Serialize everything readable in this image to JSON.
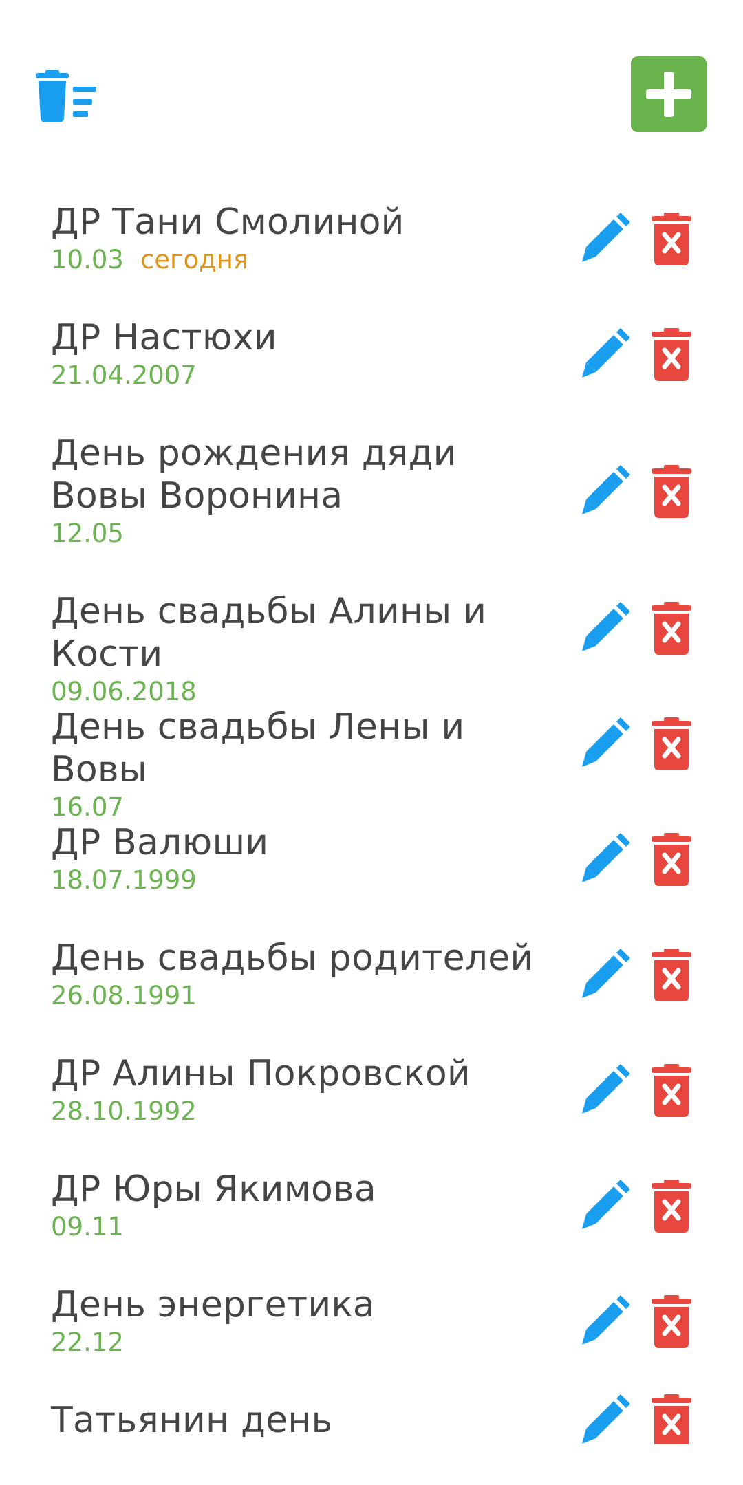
{
  "colors": {
    "accent_blue": "#1a9ff0",
    "add_green": "#6ab24f",
    "delete_red": "#e8473f",
    "date_green": "#6cb352",
    "today_orange": "#e0961a",
    "title_text": "#454545"
  },
  "toolbar": {
    "clear_icon": "trash-list-icon",
    "add_icon": "plus-icon"
  },
  "events": [
    {
      "title": "ДР Тани Смолиной",
      "date": "10.03",
      "today": "сегодня"
    },
    {
      "title": "ДР Настюхи",
      "date": "21.04.2007",
      "today": ""
    },
    {
      "title": "День рождения дяди Вовы Воронина",
      "date": "12.05",
      "today": ""
    },
    {
      "title": "День свадьбы Алины и Кости",
      "date": "09.06.2018",
      "today": ""
    },
    {
      "title": "День свадьбы Лены и Вовы",
      "date": "16.07",
      "today": ""
    },
    {
      "title": "ДР Валюши",
      "date": "18.07.1999",
      "today": ""
    },
    {
      "title": "День свадьбы родителей",
      "date": "26.08.1991",
      "today": ""
    },
    {
      "title": "ДР Алины Покровской",
      "date": "28.10.1992",
      "today": ""
    },
    {
      "title": "ДР Юры Якимова",
      "date": "09.11",
      "today": ""
    },
    {
      "title": "День энергетика",
      "date": "22.12",
      "today": ""
    },
    {
      "title": "Татьянин день",
      "date": "",
      "today": ""
    }
  ]
}
